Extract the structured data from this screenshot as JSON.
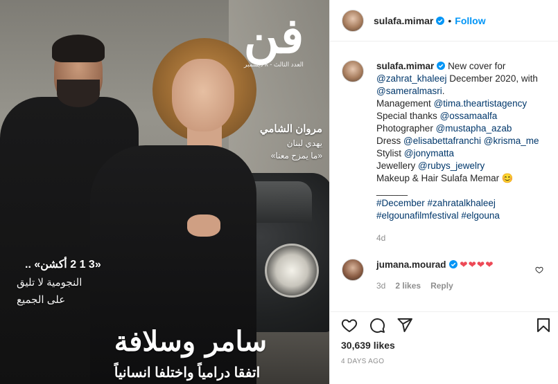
{
  "cover": {
    "logo_mark": "فن",
    "logo_sub": "العدد الثالث - ٨ ديسمبر",
    "name_right": "مروان الشامي",
    "right_line1": "يهدي لبنان",
    "right_line2": "«ما يمزح معنا»",
    "left_title": "«3 1 2 أكشن» ..",
    "left_line1": "النجومية لا تليق",
    "left_line2": "على الجميع",
    "headline": "سامر وسلافة",
    "subheadline": "اتفقا درامياً واختلفا انسانياً"
  },
  "header": {
    "username": "sulafa.mimar",
    "dot": "•",
    "follow": "Follow"
  },
  "caption": {
    "username": "sulafa.mimar",
    "line1_text": "New cover for",
    "line2_link": "@zahrat_khaleej",
    "line2_text": " December 2020, with",
    "line3_link": "@sameralmasri",
    "line3_text": ".",
    "line4_text": "Management ",
    "line4_link": "@tima.theartistagency",
    "line5_text": "Special thanks ",
    "line5_link": "@ossamaalfa",
    "line6_text": "Photographer ",
    "line6_link": "@mustapha_azab",
    "line7_text": "Dress ",
    "line7_link1": "@elisabettafranchi",
    "line7_link2": "@krisma_me",
    "line8_text": "Stylist ",
    "line8_link": "@jonymatta",
    "line9_text": "Jewellery ",
    "line9_link": "@rubys_jewelry",
    "line10_text": "Makeup & Hair Sulafa Memar ",
    "line10_emoji": "😊",
    "dashes": "______",
    "tag1": "#December",
    "tag2": "#zahratalkhaleej",
    "tag3": "#elgounafilmfestival",
    "tag4": "#elgouna",
    "time": "4d"
  },
  "comment": {
    "username": "jumana.mourad",
    "text": "❤❤❤❤",
    "time": "3d",
    "likes": "2 likes",
    "reply": "Reply"
  },
  "footer": {
    "likes": "30,639 likes",
    "date": "4 DAYS AGO"
  },
  "colors": {
    "link": "#00376b",
    "follow": "#0095f6",
    "verified": "#0095f6",
    "heart": "#ed4956"
  }
}
